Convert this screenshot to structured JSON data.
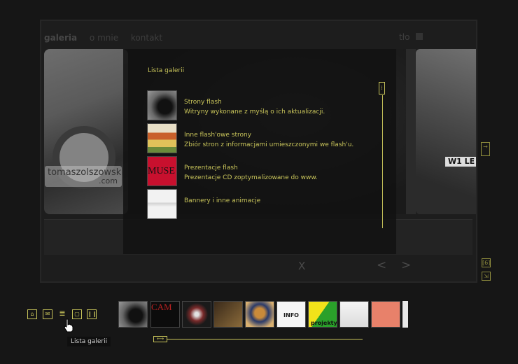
{
  "nav": {
    "items": [
      "galeria",
      "o mnie",
      "kontakt"
    ],
    "tlo": "tło"
  },
  "watermark": {
    "line1": "tomaszolszowski",
    "line2": ".com"
  },
  "plate_text": "W1 LE",
  "overlay": {
    "title": "Lista galerii",
    "items": [
      {
        "title": "Strony flash",
        "desc": "Witryny wykonane z myślą o ich aktualizacji."
      },
      {
        "title": "Inne flash'owe strony",
        "desc": "Zbiór stron z informacjami umieszczonymi we flash'u."
      },
      {
        "title": "Prezentacje flash",
        "desc": "Prezentacje CD zoptymalizowane do www."
      },
      {
        "title": "Bannery i inne animacje",
        "desc": ""
      }
    ],
    "thumb_texts": {
      "muse": "MUSE"
    }
  },
  "controls": {
    "close": "X",
    "prev": "<",
    "next": ">"
  },
  "side_buttons": {
    "next_arrow": "→",
    "fullscreen": "[6]"
  },
  "strip": {
    "thumb_labels": [
      "",
      "CAM",
      "",
      "",
      "",
      "INFO",
      "projekty",
      "",
      "",
      ""
    ]
  },
  "tooltip": "Lista galerii",
  "colors": {
    "accent": "#c8c45a",
    "background": "#161616"
  }
}
